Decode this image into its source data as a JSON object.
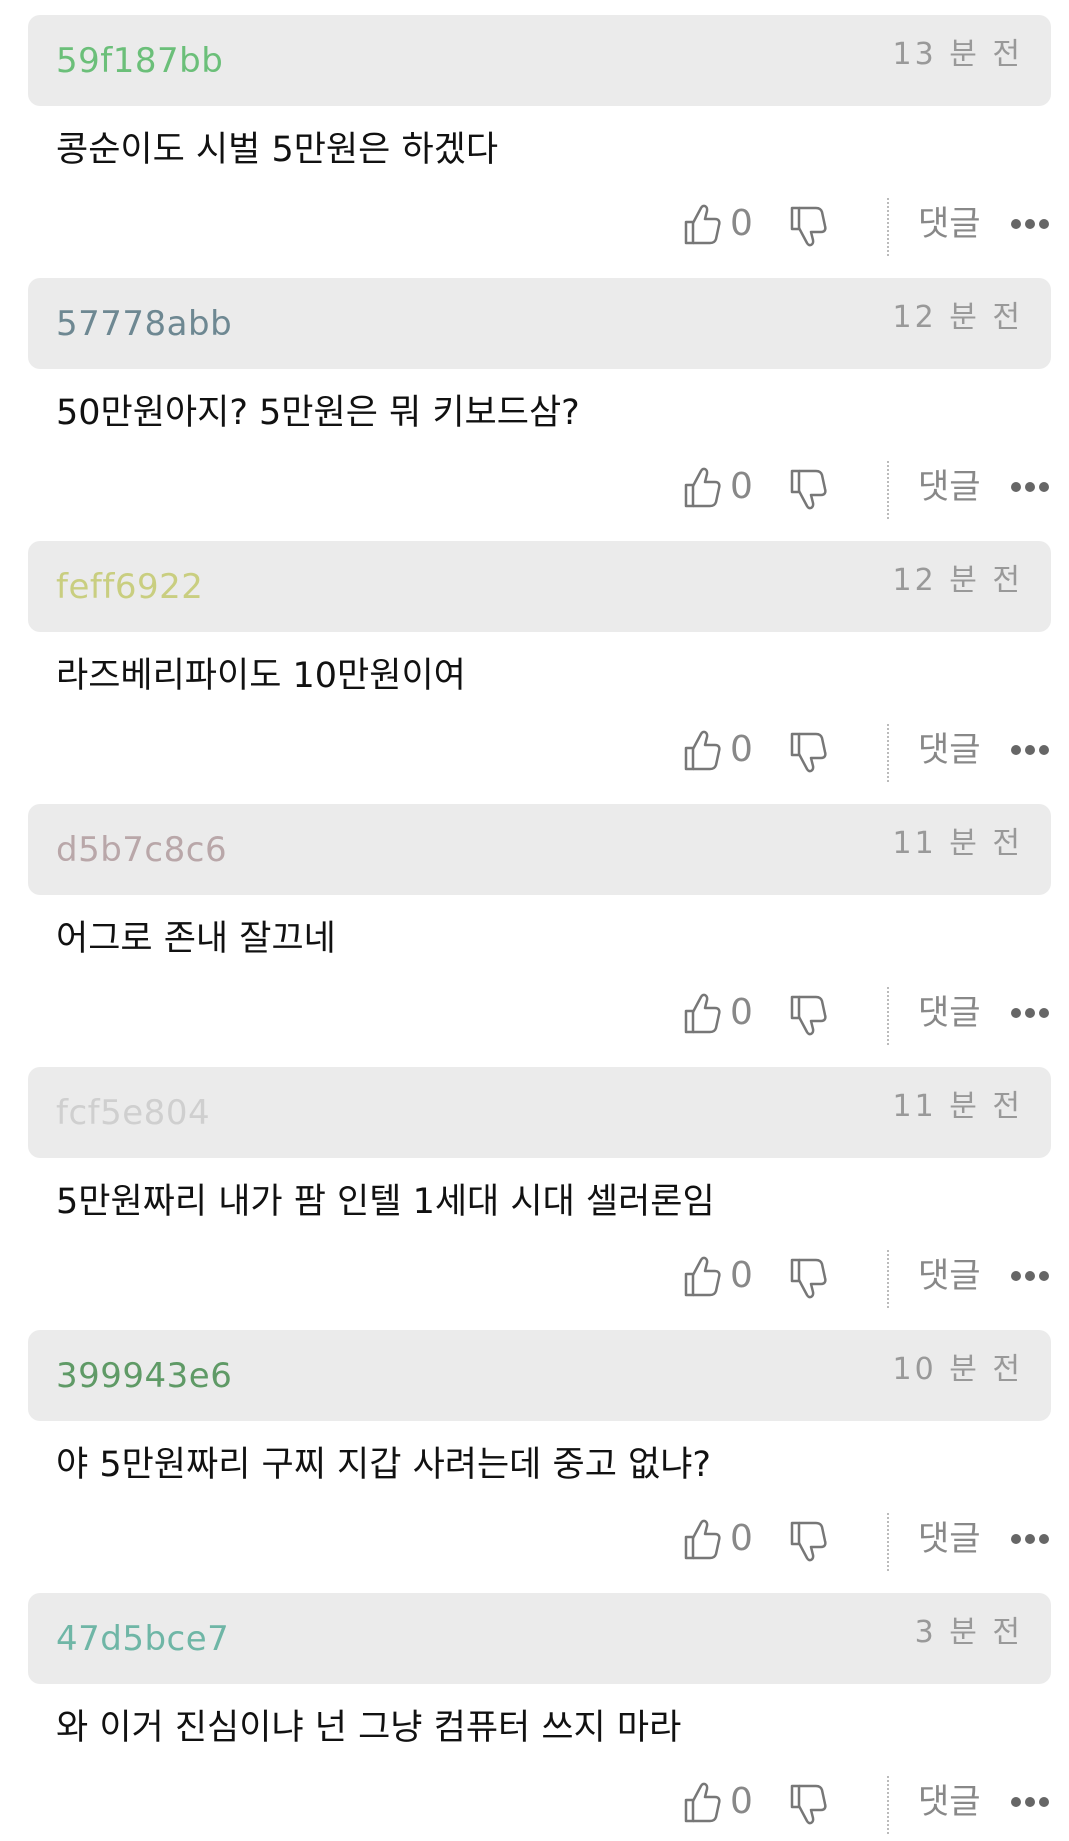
{
  "reply_label": "댓글",
  "comments": [
    {
      "author": "59f187bb",
      "author_color": "#6bbf79",
      "time": "13 분 전",
      "text": "콩순이도 시벌 5만원은 하겠다",
      "likes": "0"
    },
    {
      "author": "57778abb",
      "author_color": "#6e8892",
      "time": "12 분 전",
      "text": "50만원아지? 5만원은 뭐 키보드삼?",
      "likes": "0"
    },
    {
      "author": "feff6922",
      "author_color": "#c9ce80",
      "time": "12 분 전",
      "text": "라즈베리파이도 10만원이여",
      "likes": "0"
    },
    {
      "author": "d5b7c8c6",
      "author_color": "#b9a7a9",
      "time": "11 분 전",
      "text": "어그로 존내 잘끄네",
      "likes": "0"
    },
    {
      "author": "fcf5e804",
      "author_color": "#cfcfcf",
      "time": "11 분 전",
      "text": "5만원짜리 내가 팜 인텔 1세대 시대 셀러론임",
      "likes": "0"
    },
    {
      "author": "399943e6",
      "author_color": "#5f9a66",
      "time": "10 분 전",
      "text": "야 5만원짜리 구찌 지갑 사려는데 중고 없냐?",
      "likes": "0"
    },
    {
      "author": "47d5bce7",
      "author_color": "#6fb6a6",
      "time": "3 분 전",
      "text": "와 이거 진심이냐 넌 그냥 컴퓨터 쓰지 마라",
      "likes": "0"
    }
  ]
}
